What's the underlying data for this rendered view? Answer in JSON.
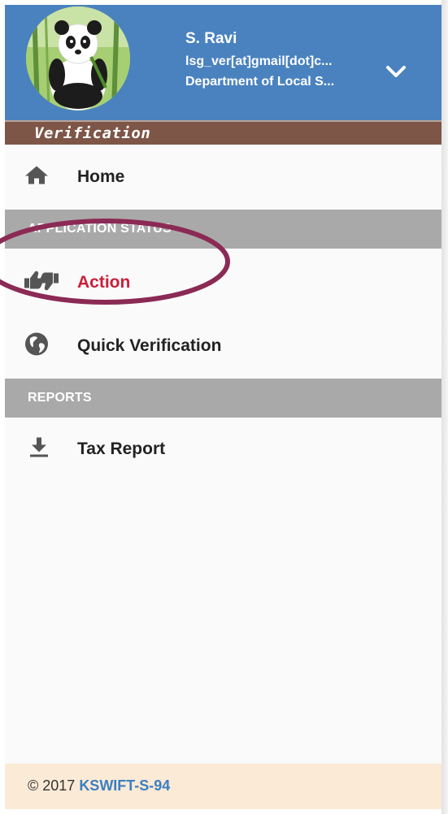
{
  "user": {
    "name": "S. Ravi",
    "email": "lsg_ver[at]gmail[dot]c...",
    "department": "Department of Local S..."
  },
  "brand": {
    "label": "Verification"
  },
  "menu": {
    "home_label": "Home",
    "section_application": "APPLICATION STATUS",
    "action_label": "Action",
    "quick_verification_label": "Quick Verification",
    "section_reports": "REPORTS",
    "tax_report_label": "Tax Report"
  },
  "footer": {
    "copyright": "© 2017 ",
    "link": "KSWIFT-S-94"
  },
  "icons": {
    "home": "home-icon",
    "action": "thumbs-icon",
    "quick_verification": "globe-icon",
    "tax_report": "download-icon",
    "dropdown": "chevron-down-icon"
  },
  "colors": {
    "header_bg": "#4a82bf",
    "brand_bar": "#7e5648",
    "section_bg": "#a9a9a9",
    "active_text": "#c8203b",
    "footer_bg": "#fbead6",
    "footer_link": "#3b7fc0",
    "annotation_ring": "#8b2a55"
  }
}
